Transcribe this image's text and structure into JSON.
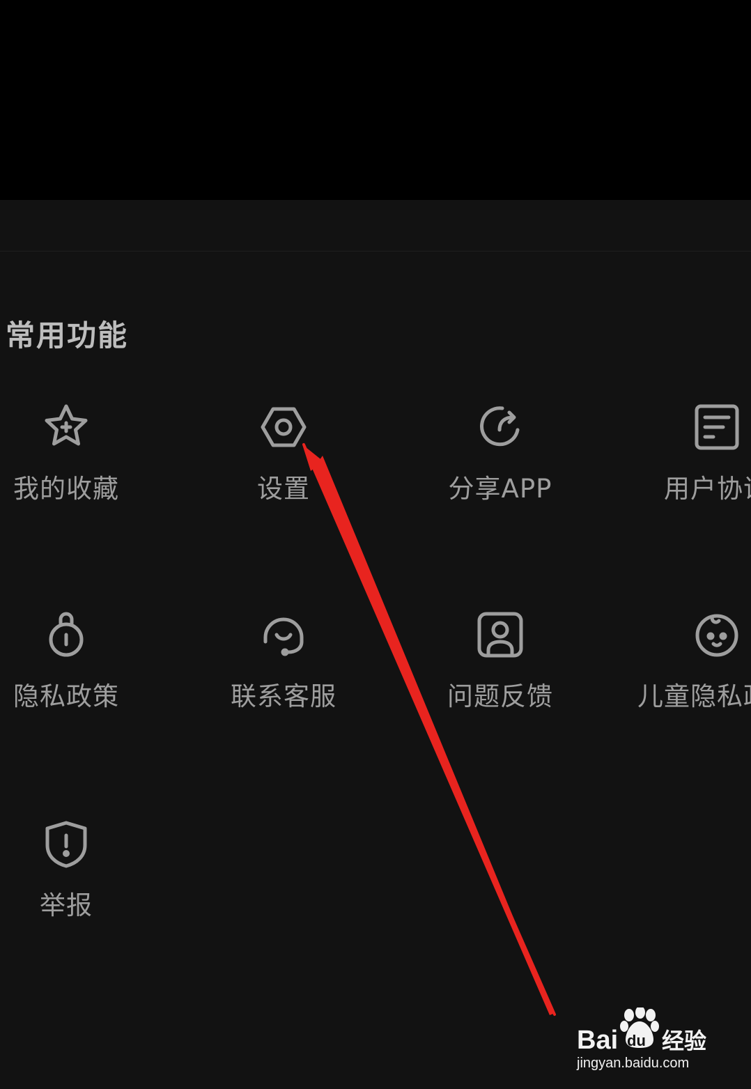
{
  "section": {
    "title": "常用功能"
  },
  "items": [
    {
      "label": "我的收藏",
      "icon": "star-plus-icon"
    },
    {
      "label": "设置",
      "icon": "settings-hexagon-icon"
    },
    {
      "label": "分享APP",
      "icon": "share-refresh-icon"
    },
    {
      "label": "用户协议",
      "icon": "document-icon"
    },
    {
      "label": "隐私政策",
      "icon": "lock-icon"
    },
    {
      "label": "联系客服",
      "icon": "headset-icon"
    },
    {
      "label": "问题反馈",
      "icon": "feedback-person-icon"
    },
    {
      "label": "儿童隐私政策",
      "icon": "baby-face-icon"
    },
    {
      "label": "举报",
      "icon": "shield-alert-icon"
    }
  ],
  "colors": {
    "panel_bg": "#121212",
    "icon_stroke": "#9e9e9e",
    "text": "#9e9e9e",
    "title_text": "#bdbdbd",
    "arrow": "#e8241f"
  },
  "watermark": {
    "brand_latin": "Bai",
    "brand_du": "du",
    "brand_cn": "经验",
    "url": "jingyan.baidu.com"
  }
}
